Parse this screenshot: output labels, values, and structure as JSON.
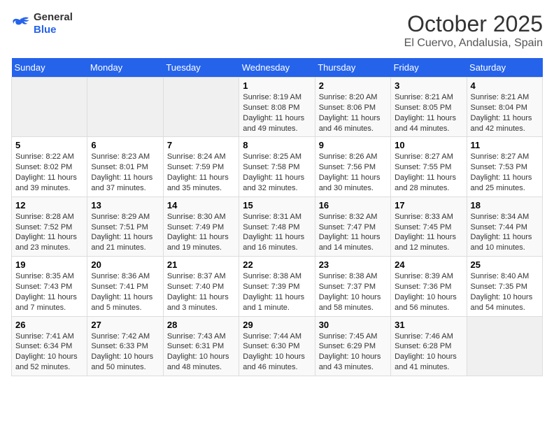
{
  "header": {
    "logo_general": "General",
    "logo_blue": "Blue",
    "month": "October 2025",
    "location": "El Cuervo, Andalusia, Spain"
  },
  "days_of_week": [
    "Sunday",
    "Monday",
    "Tuesday",
    "Wednesday",
    "Thursday",
    "Friday",
    "Saturday"
  ],
  "weeks": [
    [
      {
        "day": "",
        "info": ""
      },
      {
        "day": "",
        "info": ""
      },
      {
        "day": "",
        "info": ""
      },
      {
        "day": "1",
        "info": "Sunrise: 8:19 AM\nSunset: 8:08 PM\nDaylight: 11 hours and 49 minutes."
      },
      {
        "day": "2",
        "info": "Sunrise: 8:20 AM\nSunset: 8:06 PM\nDaylight: 11 hours and 46 minutes."
      },
      {
        "day": "3",
        "info": "Sunrise: 8:21 AM\nSunset: 8:05 PM\nDaylight: 11 hours and 44 minutes."
      },
      {
        "day": "4",
        "info": "Sunrise: 8:21 AM\nSunset: 8:04 PM\nDaylight: 11 hours and 42 minutes."
      }
    ],
    [
      {
        "day": "5",
        "info": "Sunrise: 8:22 AM\nSunset: 8:02 PM\nDaylight: 11 hours and 39 minutes."
      },
      {
        "day": "6",
        "info": "Sunrise: 8:23 AM\nSunset: 8:01 PM\nDaylight: 11 hours and 37 minutes."
      },
      {
        "day": "7",
        "info": "Sunrise: 8:24 AM\nSunset: 7:59 PM\nDaylight: 11 hours and 35 minutes."
      },
      {
        "day": "8",
        "info": "Sunrise: 8:25 AM\nSunset: 7:58 PM\nDaylight: 11 hours and 32 minutes."
      },
      {
        "day": "9",
        "info": "Sunrise: 8:26 AM\nSunset: 7:56 PM\nDaylight: 11 hours and 30 minutes."
      },
      {
        "day": "10",
        "info": "Sunrise: 8:27 AM\nSunset: 7:55 PM\nDaylight: 11 hours and 28 minutes."
      },
      {
        "day": "11",
        "info": "Sunrise: 8:27 AM\nSunset: 7:53 PM\nDaylight: 11 hours and 25 minutes."
      }
    ],
    [
      {
        "day": "12",
        "info": "Sunrise: 8:28 AM\nSunset: 7:52 PM\nDaylight: 11 hours and 23 minutes."
      },
      {
        "day": "13",
        "info": "Sunrise: 8:29 AM\nSunset: 7:51 PM\nDaylight: 11 hours and 21 minutes."
      },
      {
        "day": "14",
        "info": "Sunrise: 8:30 AM\nSunset: 7:49 PM\nDaylight: 11 hours and 19 minutes."
      },
      {
        "day": "15",
        "info": "Sunrise: 8:31 AM\nSunset: 7:48 PM\nDaylight: 11 hours and 16 minutes."
      },
      {
        "day": "16",
        "info": "Sunrise: 8:32 AM\nSunset: 7:47 PM\nDaylight: 11 hours and 14 minutes."
      },
      {
        "day": "17",
        "info": "Sunrise: 8:33 AM\nSunset: 7:45 PM\nDaylight: 11 hours and 12 minutes."
      },
      {
        "day": "18",
        "info": "Sunrise: 8:34 AM\nSunset: 7:44 PM\nDaylight: 11 hours and 10 minutes."
      }
    ],
    [
      {
        "day": "19",
        "info": "Sunrise: 8:35 AM\nSunset: 7:43 PM\nDaylight: 11 hours and 7 minutes."
      },
      {
        "day": "20",
        "info": "Sunrise: 8:36 AM\nSunset: 7:41 PM\nDaylight: 11 hours and 5 minutes."
      },
      {
        "day": "21",
        "info": "Sunrise: 8:37 AM\nSunset: 7:40 PM\nDaylight: 11 hours and 3 minutes."
      },
      {
        "day": "22",
        "info": "Sunrise: 8:38 AM\nSunset: 7:39 PM\nDaylight: 11 hours and 1 minute."
      },
      {
        "day": "23",
        "info": "Sunrise: 8:38 AM\nSunset: 7:37 PM\nDaylight: 10 hours and 58 minutes."
      },
      {
        "day": "24",
        "info": "Sunrise: 8:39 AM\nSunset: 7:36 PM\nDaylight: 10 hours and 56 minutes."
      },
      {
        "day": "25",
        "info": "Sunrise: 8:40 AM\nSunset: 7:35 PM\nDaylight: 10 hours and 54 minutes."
      }
    ],
    [
      {
        "day": "26",
        "info": "Sunrise: 7:41 AM\nSunset: 6:34 PM\nDaylight: 10 hours and 52 minutes."
      },
      {
        "day": "27",
        "info": "Sunrise: 7:42 AM\nSunset: 6:33 PM\nDaylight: 10 hours and 50 minutes."
      },
      {
        "day": "28",
        "info": "Sunrise: 7:43 AM\nSunset: 6:31 PM\nDaylight: 10 hours and 48 minutes."
      },
      {
        "day": "29",
        "info": "Sunrise: 7:44 AM\nSunset: 6:30 PM\nDaylight: 10 hours and 46 minutes."
      },
      {
        "day": "30",
        "info": "Sunrise: 7:45 AM\nSunset: 6:29 PM\nDaylight: 10 hours and 43 minutes."
      },
      {
        "day": "31",
        "info": "Sunrise: 7:46 AM\nSunset: 6:28 PM\nDaylight: 10 hours and 41 minutes."
      },
      {
        "day": "",
        "info": ""
      }
    ]
  ]
}
